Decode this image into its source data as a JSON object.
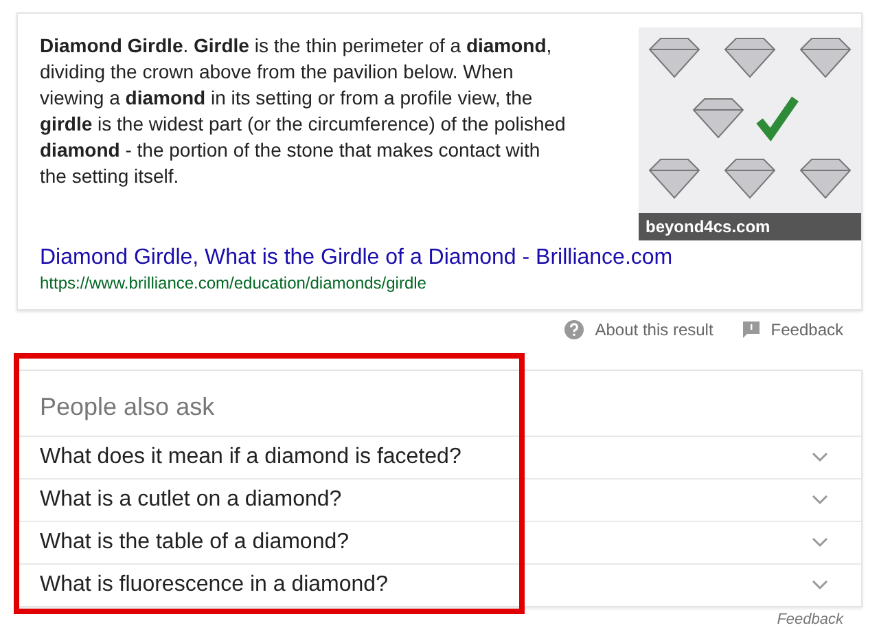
{
  "featured_snippet": {
    "text": "**Diamond Girdle**. **Girdle** is the thin perimeter of a **diamond**, dividing the crown above from the pavilion below. When viewing a **diamond** in its setting or from a profile view, the **girdle** is the widest part (or the circumference) of the polished **diamond** - the portion of the stone that makes contact with the setting itself.",
    "image_caption": "beyond4cs.com",
    "link_title": "Diamond Girdle, What is the Girdle of a Diamond - Brilliance.com",
    "url": "https://www.brilliance.com/education/diamonds/girdle"
  },
  "result_actions": [
    "About this result",
    "Feedback"
  ],
  "people_also_ask": {
    "title": "People also ask",
    "highlighted": true,
    "questions": [
      {
        "text": "What does it mean if a diamond is faceted?",
        "expanded": false
      },
      {
        "text": "What is a cutlet on a diamond?",
        "expanded": false
      },
      {
        "text": "What is the table of a diamond?",
        "expanded": false
      },
      {
        "text": "What is fluorescence in a diamond?",
        "expanded": false
      }
    ],
    "feedback": "Feedback"
  }
}
